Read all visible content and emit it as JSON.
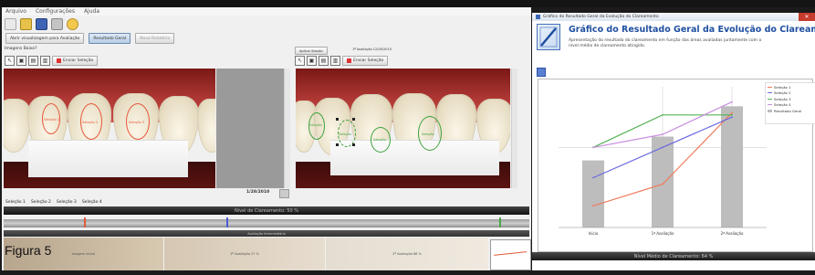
{
  "caption": "Figura 5",
  "menu": {
    "items": [
      "Arquivo",
      "Configurações",
      "Ajuda"
    ]
  },
  "toolbar2": {
    "btn1": "Abrir visualizagem para Avaliação",
    "btn2": "Resultado Geral",
    "btn3": "Novo Relatório"
  },
  "left_panel": {
    "label": "Imagens Baixo?",
    "tool_label": "Enviar Seleção"
  },
  "right_panel": {
    "label": "Aplicar Sessão",
    "header": "1ª Avaliação 12/05/2010",
    "tool_label": "Enviar Seleção"
  },
  "photo_left": {
    "selections": [
      "Seleção 1",
      "Seleção 2",
      "Seleção 3"
    ]
  },
  "photo_right": {
    "selections": [
      "Seleção",
      "Seleção",
      "Seleção",
      "Seleção"
    ]
  },
  "date": "1/28/2010",
  "selections_bar": [
    "Seleção 1",
    "Seleção 2",
    "Seleção 3",
    "Seleção 4"
  ],
  "nivel_bar": "Nível de Clareamento: 50 %",
  "eval_bar": "Avaliação Intermediária",
  "strips": [
    "Imagem Inicial",
    "1ª Avaliação 27 %",
    "2ª Avaliação 88 %"
  ],
  "right_window": {
    "title": "Gráfico do Resultado Geral da Evolução do Clareamento",
    "close": "✕",
    "heading": "Gráfico do Resultado Geral da Evolução do Clareamento",
    "desc": "Apresentação do resultado do clareamento em função das áreas avaliadas juntamente com o nível médio de clareamento atingido.",
    "footer": "Nível Médio de Clareamento: 64 %"
  },
  "chart_data": {
    "type": "bar",
    "categories": [
      "Inicio",
      "1ª Avaliação",
      "2ª Avaliação"
    ],
    "bars": {
      "name": "Resultado Geral",
      "values": [
        31,
        42,
        56
      ]
    },
    "series": [
      {
        "name": "Seleção 1",
        "color": "#f07a5a",
        "values": [
          10,
          20,
          53
        ]
      },
      {
        "name": "Seleção 2",
        "color": "#6a6ae0",
        "values": [
          23,
          37,
          51
        ]
      },
      {
        "name": "Seleção 3",
        "color": "#56b356",
        "values": [
          37,
          52,
          52
        ]
      },
      {
        "name": "Seleção 4",
        "color": "#c88ee0",
        "values": [
          37,
          43,
          58
        ]
      }
    ],
    "ylim": [
      0,
      65
    ]
  },
  "colors": {
    "title_blue": "#1f4fa0",
    "bar_gray": "#bdbdbd"
  }
}
